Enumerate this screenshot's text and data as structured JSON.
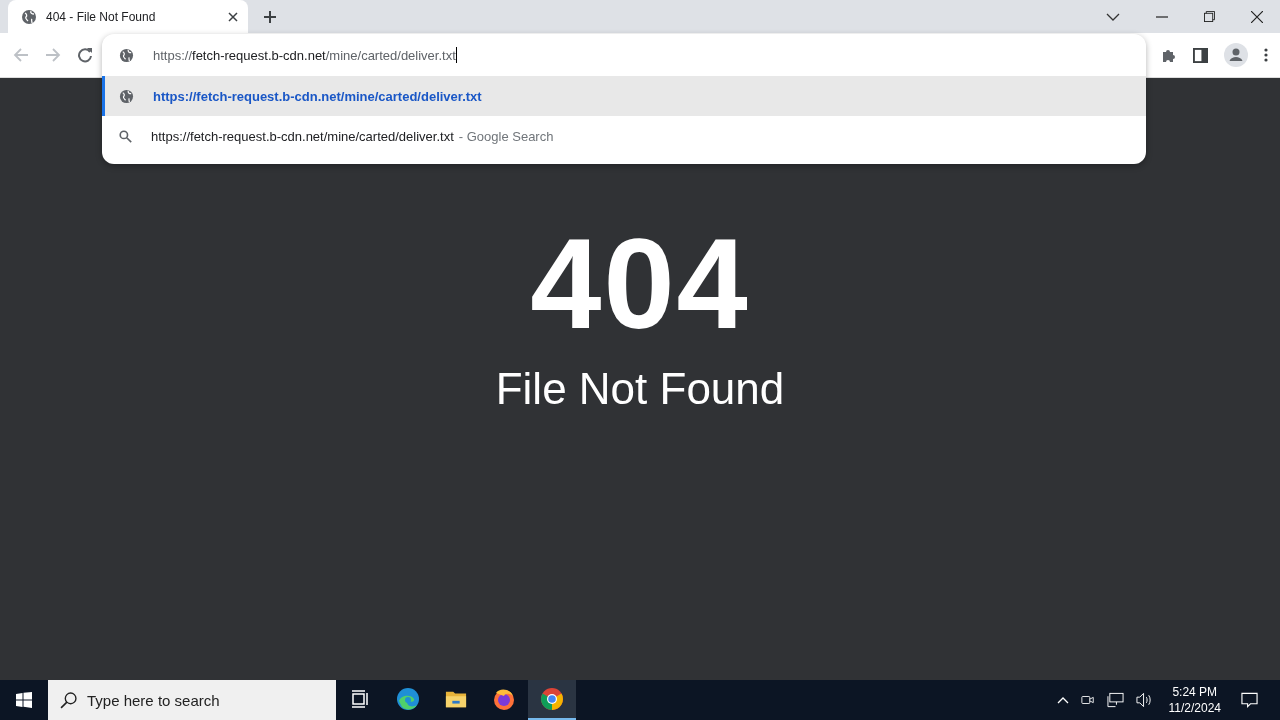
{
  "tabs": [
    {
      "title": "404 - File Not Found",
      "selected": true
    }
  ],
  "omnibox": {
    "scheme": "https://",
    "host": "fetch-request.b-cdn.net",
    "path": "/mine/carted/deliver.txt"
  },
  "suggestions": [
    {
      "kind": "url",
      "text": "https://fetch-request.b-cdn.net/mine/carted/deliver.txt",
      "selected": true
    },
    {
      "kind": "search",
      "text": "https://fetch-request.b-cdn.net/mine/carted/deliver.txt",
      "suffix": "- Google Search",
      "selected": false
    }
  ],
  "page": {
    "code": "404",
    "message": "File Not Found"
  },
  "taskbar": {
    "search_placeholder": "Type here to search",
    "apps": [
      {
        "kind": "taskview",
        "active": false
      },
      {
        "kind": "edge",
        "active": false
      },
      {
        "kind": "explorer",
        "active": false
      },
      {
        "kind": "firefox",
        "active": false
      },
      {
        "kind": "chrome",
        "active": true
      }
    ],
    "time": "5:24 PM",
    "date": "11/2/2024"
  }
}
